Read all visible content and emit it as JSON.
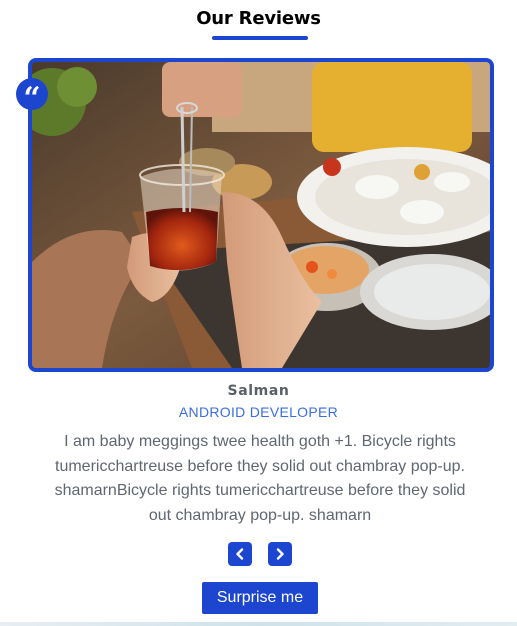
{
  "header": {
    "title": "Our Reviews"
  },
  "review": {
    "quote_icon": "quote-icon",
    "image_description": "photo",
    "name": "Salman",
    "role": "ANDROID DEVELOPER",
    "text": "I am baby meggings twee health goth +1. Bicycle rights tumericchartreuse before they solid out chambray pop-up. shamarnBicycle rights tumericchartreuse before they solid out chambray pop-up. shamarn"
  },
  "controls": {
    "prev_icon": "chevron-left-icon",
    "next_icon": "chevron-right-icon",
    "surprise_label": "Surprise me"
  },
  "colors": {
    "accent": "#1c46cf",
    "role": "#3a6ee0",
    "text": "#606770",
    "name": "#5a5f66"
  }
}
